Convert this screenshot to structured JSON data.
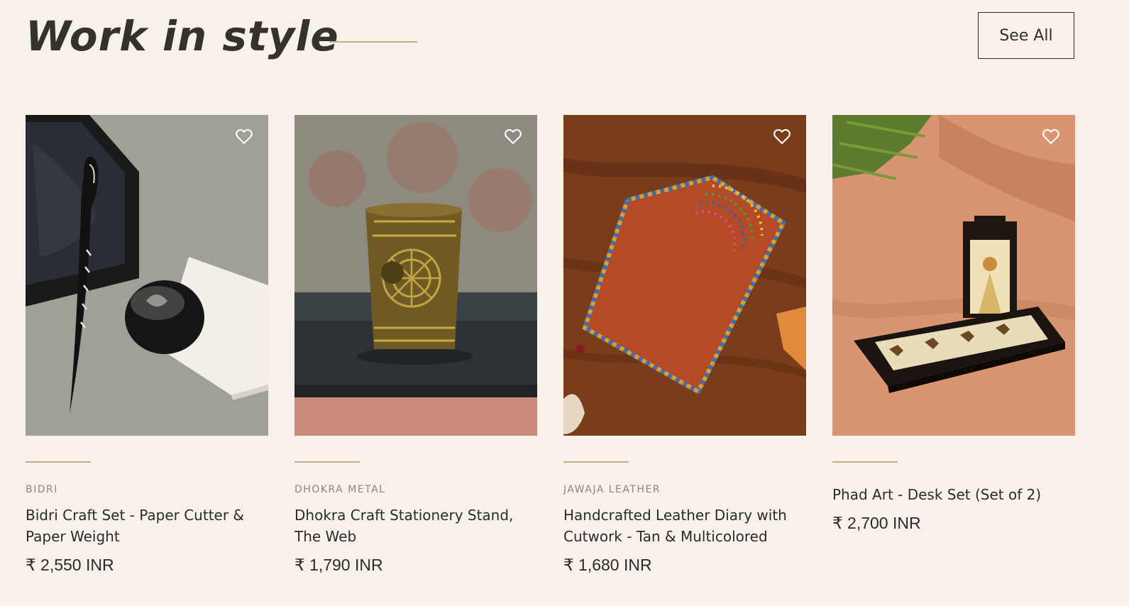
{
  "section": {
    "title": "Work in style",
    "see_all_label": "See All"
  },
  "colors": {
    "background": "#f7f1ea",
    "accent_rule": "#c9ab85",
    "text": "#2b2b2b",
    "vendor_text": "#8d8679"
  },
  "products": [
    {
      "vendor": "BIDRI",
      "title": "Bidri Craft Set - Paper Cutter & Paper Weight",
      "price": "₹ 2,550 INR",
      "image_subject": "black-bidri-paper-cutter-and-paperweight"
    },
    {
      "vendor": "DHOKRA METAL",
      "title": "Dhokra Craft Stationery Stand, The Web",
      "price": "₹ 1,790 INR",
      "image_subject": "brass-dhokra-web-stand"
    },
    {
      "vendor": "JAWAJA LEATHER",
      "title": "Handcrafted Leather Diary with Cutwork - Tan & Multicolored",
      "price": "₹ 1,680 INR",
      "image_subject": "tan-leather-diary"
    },
    {
      "vendor": "",
      "title": "Phad Art - Desk Set (Set of 2)",
      "price": "₹ 2,700 INR",
      "image_subject": "phad-art-desk-tray-and-pen-stand"
    }
  ],
  "icons": {
    "wishlist": "heart-outline-icon"
  }
}
